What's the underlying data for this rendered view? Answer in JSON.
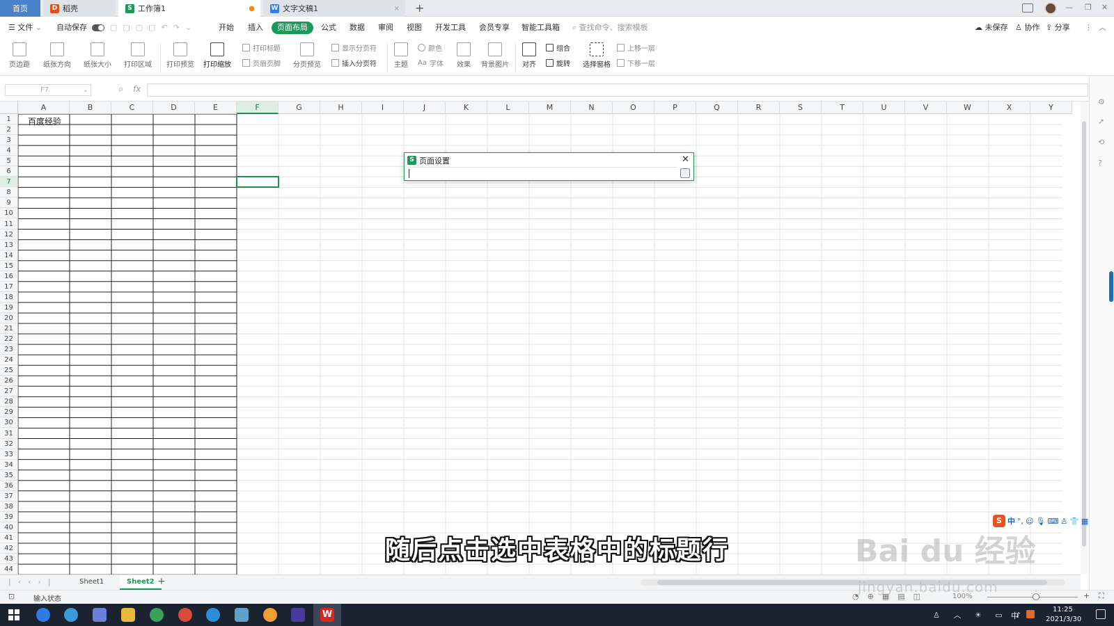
{
  "tabs": [
    {
      "label": "首页",
      "active": true
    },
    {
      "label": "稻壳",
      "icon": "docer-icon"
    },
    {
      "label": "工作簿1",
      "icon": "sheet-icon",
      "modified": "●"
    },
    {
      "label": "文字文稿1",
      "icon": "writer-icon",
      "close": "×"
    }
  ],
  "titlebar": {
    "new_tab": "+",
    "window_buttons": [
      "—",
      "❐",
      "✕"
    ]
  },
  "menu": {
    "file": "文件",
    "autosave": "自动保存",
    "items": [
      "开始",
      "插入",
      "页面布局",
      "公式",
      "数据",
      "审阅",
      "视图",
      "开发工具",
      "会员专享",
      "智能工具箱"
    ],
    "active": "页面布局",
    "search_placeholder": "查找命令、搜索模板",
    "unsaved": "未保存",
    "collab": "协作",
    "share": "分享"
  },
  "ribbon": {
    "big": [
      "页边距",
      "纸张方向",
      "纸张大小",
      "打印区域",
      "打印预览",
      "打印缩放",
      "分页预览",
      "主题",
      "效果",
      "背景图片",
      "对齐",
      "选择窗格"
    ],
    "small": [
      "打印标题",
      "页眉页脚",
      "显示分页符",
      "插入分页符",
      "颜色",
      "字体",
      "组合",
      "旋转",
      "上移一层",
      "下移一层"
    ]
  },
  "formula_bar": {
    "cell_ref": "F7",
    "fx": "fx",
    "value": ""
  },
  "grid": {
    "columns": [
      "A",
      "B",
      "C",
      "D",
      "E",
      "F",
      "G",
      "H",
      "I",
      "J",
      "K",
      "L",
      "M",
      "N",
      "O",
      "P",
      "Q",
      "R",
      "S",
      "T",
      "U",
      "V",
      "W",
      "X",
      "Y"
    ],
    "row_count": 44,
    "selected_column": "F",
    "selected_row": 7,
    "cell_A1": "百度经验"
  },
  "dialog": {
    "title": "页面设置",
    "close": "✕",
    "input_value": ""
  },
  "sheets": {
    "tabs": [
      "Sheet1",
      "Sheet2"
    ],
    "active": "Sheet2",
    "add": "+"
  },
  "status": {
    "mode": "输入状态",
    "zoom": "100%"
  },
  "caption": "随后点击选中表格中的标题行",
  "watermark": {
    "main": "Bai du 经验",
    "url": "jingyan.baidu.com"
  },
  "ime": {
    "lang": "中"
  },
  "taskbar": {
    "time": "11:25",
    "date": "2021/3/30",
    "lang": "中"
  },
  "colors": {
    "accent": "#1a9a5a",
    "selection": "#1e8f4e",
    "taskbar": "#1b2330"
  }
}
